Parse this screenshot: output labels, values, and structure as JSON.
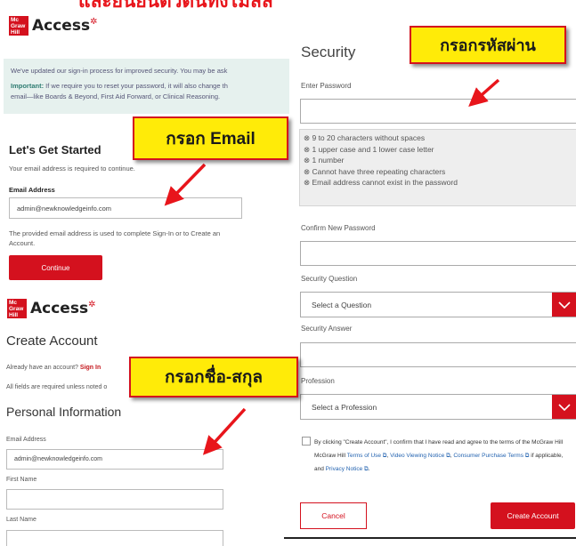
{
  "banner": {
    "title": "และยืนยันตัวตนทั้งไม่ลิล"
  },
  "logo": {
    "brand_text": "Access",
    "mark_lines": [
      "Mc",
      "Graw",
      "Hill"
    ]
  },
  "signin": {
    "notice_line1": "We've updated our sign-in process for improved security. You may be ask",
    "notice_important": "Important:",
    "notice_line2": " If we require you to reset your password, it will also change th",
    "notice_line3": "email—like Boards & Beyond, First Aid Forward, or Clinical Reasoning.",
    "heading": "Let's Get Started",
    "subtext": "Your email address is required to continue.",
    "email_label": "Email Address",
    "email_value": "admin@newknowledgeinfo.com",
    "helper_line1": "The provided email address is used to complete Sign-In or to Create an",
    "helper_line2": "Account.",
    "continue_label": "Continue"
  },
  "create_account": {
    "heading": "Create Account",
    "have_account": "Already have an account?",
    "sign_in_link": "Sign In",
    "required_note": "All fields are required unless noted o",
    "personal_heading": "Personal Information",
    "email_label": "Email Address",
    "email_value": "admin@newknowledgeinfo.com",
    "first_name_label": "First Name",
    "first_name_value": "",
    "last_name_label": "Last Name",
    "last_name_value": ""
  },
  "security": {
    "heading": "Security",
    "enter_password_label": "Enter Password",
    "password_rules": [
      "9 to 20 characters without spaces",
      "1 upper case and 1 lower case letter",
      "1 number",
      "Cannot have three repeating characters",
      "Email address cannot exist in the password"
    ],
    "confirm_label": "Confirm New Password",
    "question_label": "Security Question",
    "question_placeholder": "Select a Question",
    "answer_label": "Security Answer",
    "profession_label": "Profession",
    "profession_placeholder": "Select a Profession",
    "consent_prefix": "By clicking \"Create Account\", I confirm that I have read and agree to the terms of the McGraw Hill McGraw Hill ",
    "terms_link": "Terms of Use ⧉",
    "video_link": "Video Viewing Notice ⧉",
    "consumer_link": "Consumer Purchase Terms ⧉",
    "consent_mid": " if applicable, and ",
    "privacy_link": "Privacy Notice ⧉",
    "cancel_label": "Cancel",
    "create_label": "Create Account"
  },
  "callouts": {
    "password": "กรอกรหัสผ่าน",
    "email": "กรอก Email",
    "name": "กรอกชื่อ-สกุล"
  },
  "colors": {
    "brand_red": "#d4111e",
    "callout_yellow": "#ffeb08",
    "notice_bg": "#e6f1ee"
  }
}
